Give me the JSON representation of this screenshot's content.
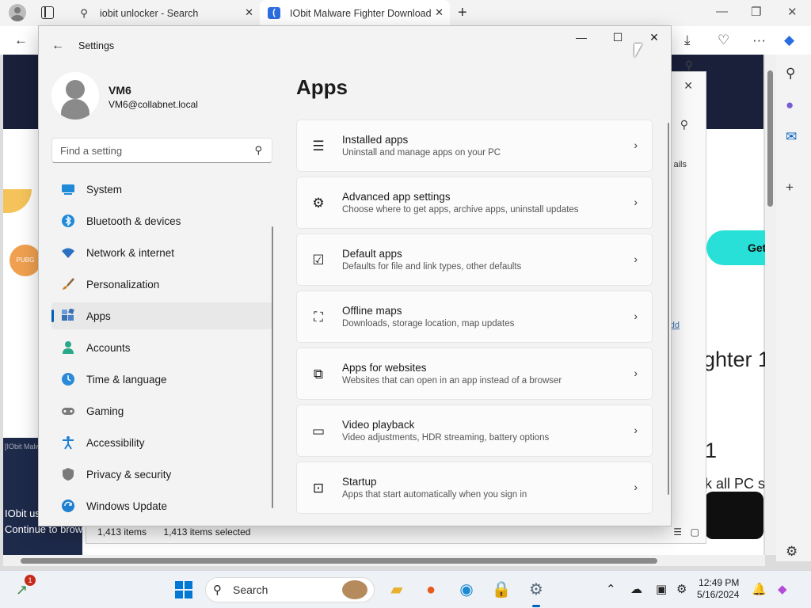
{
  "browser": {
    "tabs": [
      {
        "label": "iobit unlocker - Search",
        "icon": "search-icon"
      },
      {
        "label": "IObit Malware Fighter Download",
        "icon": "iobit-favicon"
      }
    ],
    "page": {
      "cta_fragment": "Get",
      "heading_fragment": "ghter 1",
      "number_fragment": "1",
      "subtext_fragment": "k all PC se",
      "left_box_fragment": "[IObit Malw",
      "left_text_1": "IObit us",
      "left_text_2": "Continue to brow",
      "badge_fragment": "PUBG"
    }
  },
  "explorer": {
    "status_items": "1,413 items",
    "status_selected": "1,413 items selected",
    "fragment_details": "ails",
    "fragment_add": "dd"
  },
  "settings": {
    "window_title": "Settings",
    "user": {
      "name": "VM6",
      "email": "VM6@collabnet.local"
    },
    "search_placeholder": "Find a setting",
    "nav": [
      {
        "label": "System",
        "icon": "display-icon",
        "color": "#1e8ad8"
      },
      {
        "label": "Bluetooth & devices",
        "icon": "bluetooth-icon",
        "color": "#1e8ad8"
      },
      {
        "label": "Network & internet",
        "icon": "wifi-icon",
        "color": "#2b6fc2"
      },
      {
        "label": "Personalization",
        "icon": "brush-icon",
        "color": "#d0801c"
      },
      {
        "label": "Apps",
        "icon": "apps-icon",
        "color": "#3b6fb3"
      },
      {
        "label": "Accounts",
        "icon": "person-icon",
        "color": "#2ba889"
      },
      {
        "label": "Time & language",
        "icon": "globe-clock-icon",
        "color": "#2b8ad8"
      },
      {
        "label": "Gaming",
        "icon": "gamepad-icon",
        "color": "#6b6b6b"
      },
      {
        "label": "Accessibility",
        "icon": "accessibility-icon",
        "color": "#1f7fd1"
      },
      {
        "label": "Privacy & security",
        "icon": "shield-icon",
        "color": "#6b6b6b"
      },
      {
        "label": "Windows Update",
        "icon": "update-icon",
        "color": "#1f7fd1"
      }
    ],
    "active_nav": "Apps",
    "page_title": "Apps",
    "cards": [
      {
        "title": "Installed apps",
        "desc": "Uninstall and manage apps on your PC",
        "icon": "list-icon"
      },
      {
        "title": "Advanced app settings",
        "desc": "Choose where to get apps, archive apps, uninstall updates",
        "icon": "apps-gear-icon"
      },
      {
        "title": "Default apps",
        "desc": "Defaults for file and link types, other defaults",
        "icon": "default-apps-icon"
      },
      {
        "title": "Offline maps",
        "desc": "Downloads, storage location, map updates",
        "icon": "map-download-icon"
      },
      {
        "title": "Apps for websites",
        "desc": "Websites that can open in an app instead of a browser",
        "icon": "open-link-icon"
      },
      {
        "title": "Video playback",
        "desc": "Video adjustments, HDR streaming, battery options",
        "icon": "video-icon"
      },
      {
        "title": "Startup",
        "desc": "Apps that start automatically when you sign in",
        "icon": "startup-icon"
      }
    ]
  },
  "taskbar": {
    "search_label": "Search",
    "notification_count": "1",
    "time": "12:49 PM",
    "date": "5/16/2024"
  }
}
